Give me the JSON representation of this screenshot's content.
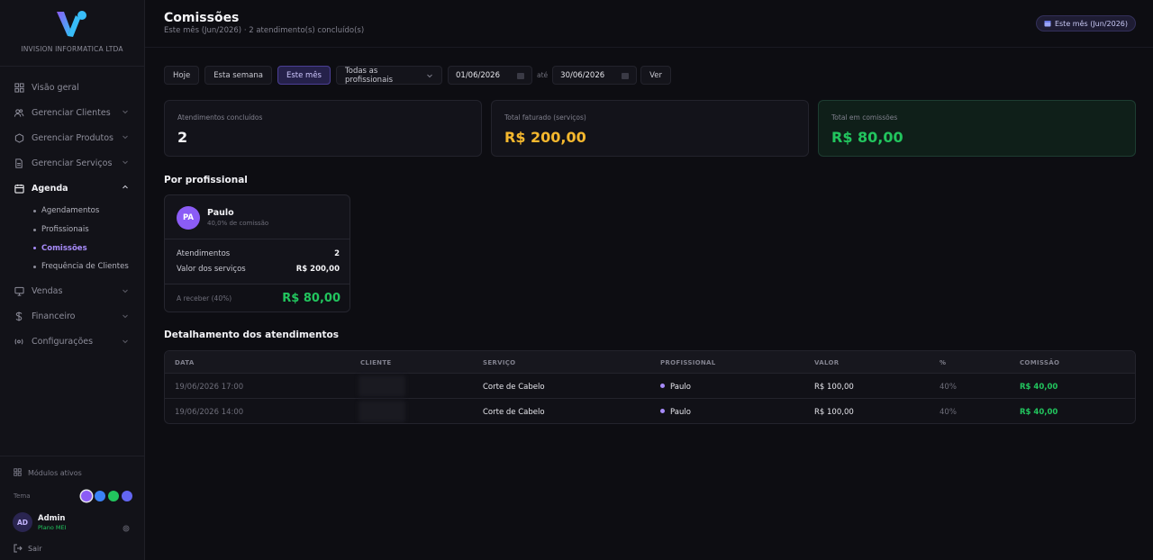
{
  "sidebar": {
    "company": "INVISION INFORMATICA LTDA",
    "nav": [
      {
        "label": "Visão geral",
        "icon": "grid-icon"
      },
      {
        "label": "Gerenciar Clientes",
        "icon": "users-icon"
      },
      {
        "label": "Gerenciar Produtos",
        "icon": "box-icon"
      },
      {
        "label": "Gerenciar Serviços",
        "icon": "document-icon"
      },
      {
        "label": "Agenda",
        "icon": "calendar-icon"
      },
      {
        "label": "Vendas",
        "icon": "monitor-icon"
      },
      {
        "label": "Financeiro",
        "icon": "dollar-icon"
      },
      {
        "label": "Configurações",
        "icon": "settings-icon"
      }
    ],
    "agenda_sub": [
      "Agendamentos",
      "Profissionais",
      "Comissões",
      "Frequência de Clientes"
    ],
    "modules_label": "Módulos ativos",
    "tema_label": "Tema",
    "tema_colors": [
      "#8b5cf6",
      "#3b82f6",
      "#22c55e",
      "#6366f1"
    ],
    "user": {
      "initials": "AD",
      "name": "Admin",
      "plan": "Plano MEI"
    },
    "logout": "Sair"
  },
  "header": {
    "title": "Comissões",
    "subtitle": "Este mês (Jun/2026) · 2 atendimento(s) concluído(s)",
    "badge": "Este mês (Jun/2026)"
  },
  "filters": {
    "hoje": "Hoje",
    "semana": "Esta semana",
    "mes": "Este mês",
    "profissionais": "Todas as profissionais",
    "date_from": "01/06/2026",
    "ate": "até",
    "date_to": "30/06/2026",
    "ver": "Ver"
  },
  "stats": [
    {
      "label": "Atendimentos concluídos",
      "value": "2",
      "color": "#f4f4f7"
    },
    {
      "label": "Total faturado (serviços)",
      "value": "R$ 200,00",
      "color": "#f5b82e"
    },
    {
      "label": "Total em comissões",
      "value": "R$ 80,00",
      "color": "#22c55e"
    }
  ],
  "por_profissional": {
    "title": "Por profissional",
    "card": {
      "initials": "PA",
      "name": "Paulo",
      "rate": "40,0% de comissão",
      "atendimentos_label": "Atendimentos",
      "atendimentos_value": "2",
      "valor_label": "Valor dos serviços",
      "valor_value": "R$ 200,00",
      "receber_label": "A receber (40%)",
      "receber_value": "R$ 80,00"
    }
  },
  "detalhamento": {
    "title": "Detalhamento dos atendimentos",
    "columns": [
      "DATA",
      "CLIENTE",
      "SERVIÇO",
      "PROFISSIONAL",
      "VALOR",
      "%",
      "COMISSÃO"
    ],
    "rows": [
      {
        "data": "19/06/2026 17:00",
        "servico": "Corte de Cabelo",
        "profissional": "Paulo",
        "valor": "R$ 100,00",
        "pct": "40%",
        "comissao": "R$ 40,00"
      },
      {
        "data": "19/06/2026 14:00",
        "servico": "Corte de Cabelo",
        "profissional": "Paulo",
        "valor": "R$ 100,00",
        "pct": "40%",
        "comissao": "R$ 40,00"
      }
    ]
  }
}
